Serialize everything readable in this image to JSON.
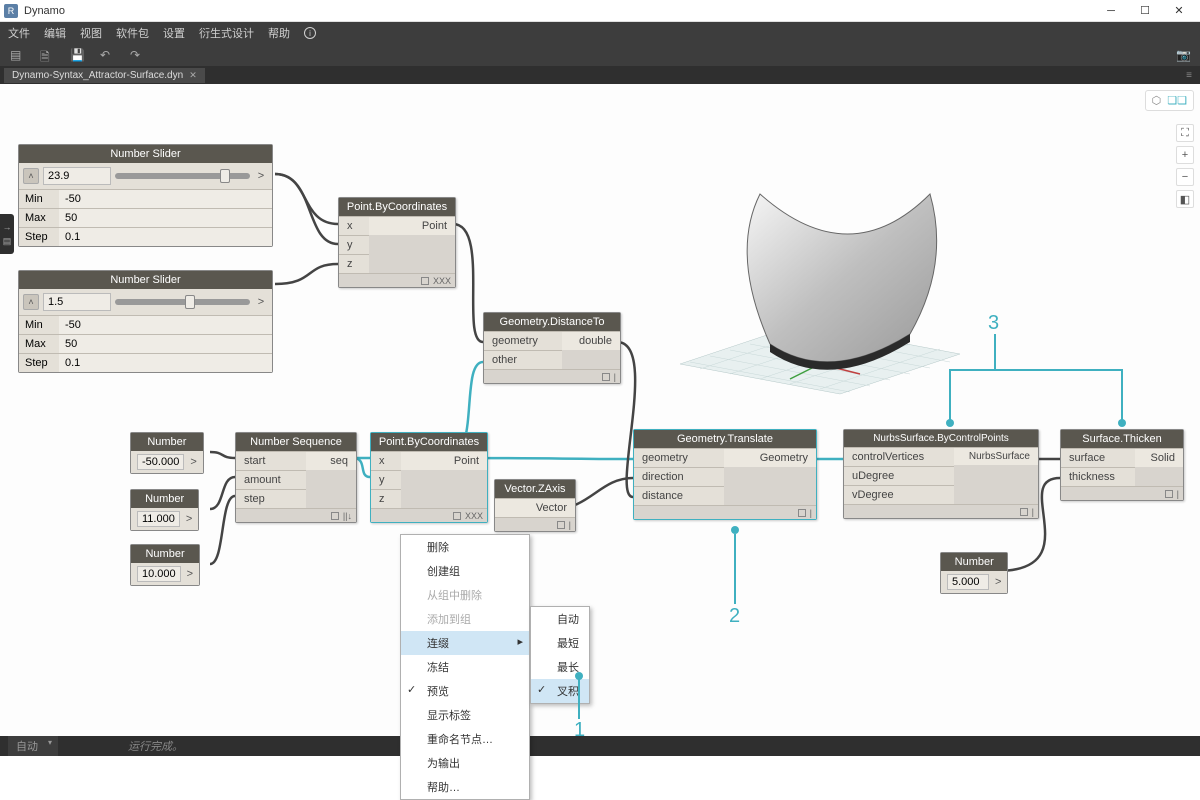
{
  "titlebar": {
    "app": "R",
    "title": "Dynamo"
  },
  "menubar": {
    "items": [
      "文件",
      "编辑",
      "视图",
      "软件包",
      "设置",
      "衍生式设计",
      "帮助"
    ]
  },
  "filetab": {
    "name": "Dynamo-Syntax_Attractor-Surface.dyn"
  },
  "nodes": {
    "slider1": {
      "title": "Number Slider",
      "value": "23.9",
      "min": "-50",
      "max": "50",
      "step": "0.1"
    },
    "slider2": {
      "title": "Number Slider",
      "value": "1.5",
      "min": "-50",
      "max": "50",
      "step": "0.1"
    },
    "num1": {
      "title": "Number",
      "value": "-50.000"
    },
    "num2": {
      "title": "Number",
      "value": "11.000"
    },
    "num3": {
      "title": "Number",
      "value": "10.000"
    },
    "num4": {
      "title": "Number",
      "value": "5.000"
    },
    "seq": {
      "title": "Number Sequence",
      "ins": [
        "start",
        "amount",
        "step"
      ],
      "outs": [
        "seq"
      ]
    },
    "pbc1": {
      "title": "Point.ByCoordinates",
      "ins": [
        "x",
        "y",
        "z"
      ],
      "outs": [
        "Point"
      ],
      "lacing": "XXX"
    },
    "pbc2": {
      "title": "Point.ByCoordinates",
      "ins": [
        "x",
        "y",
        "z"
      ],
      "outs": [
        "Point"
      ],
      "lacing": "XXX"
    },
    "dist": {
      "title": "Geometry.DistanceTo",
      "ins": [
        "geometry",
        "other"
      ],
      "outs": [
        "double"
      ]
    },
    "vec": {
      "title": "Vector.ZAxis",
      "outs": [
        "Vector"
      ]
    },
    "tran": {
      "title": "Geometry.Translate",
      "ins": [
        "geometry",
        "direction",
        "distance"
      ],
      "outs": [
        "Geometry"
      ]
    },
    "nurbs": {
      "title": "NurbsSurface.ByControlPoints",
      "ins": [
        "controlVertices",
        "uDegree",
        "vDegree"
      ],
      "outs": [
        "NurbsSurface"
      ]
    },
    "thick": {
      "title": "Surface.Thicken",
      "ins": [
        "surface",
        "thickness"
      ],
      "outs": [
        "Solid"
      ]
    }
  },
  "labels": {
    "min": "Min",
    "max": "Max",
    "step": "Step"
  },
  "ctxmenu": {
    "items": [
      {
        "t": "删除"
      },
      {
        "t": "创建组"
      },
      {
        "t": "从组中删除",
        "dis": true
      },
      {
        "t": "添加到组",
        "dis": true
      },
      {
        "t": "连缀",
        "sub": true,
        "hov": true
      },
      {
        "t": "冻结"
      },
      {
        "t": "预览",
        "ck": true
      },
      {
        "t": "显示标签"
      },
      {
        "t": "重命名节点…"
      },
      {
        "t": "为输出"
      },
      {
        "t": "帮助…"
      }
    ],
    "sub": [
      {
        "t": "自动"
      },
      {
        "t": "最短"
      },
      {
        "t": "最长"
      },
      {
        "t": "叉积",
        "ck": true,
        "hov": true
      }
    ]
  },
  "annotations": {
    "a1": "1",
    "a2": "2",
    "a3": "3"
  },
  "statusbar": {
    "mode": "自动",
    "msg": "运行完成。"
  }
}
